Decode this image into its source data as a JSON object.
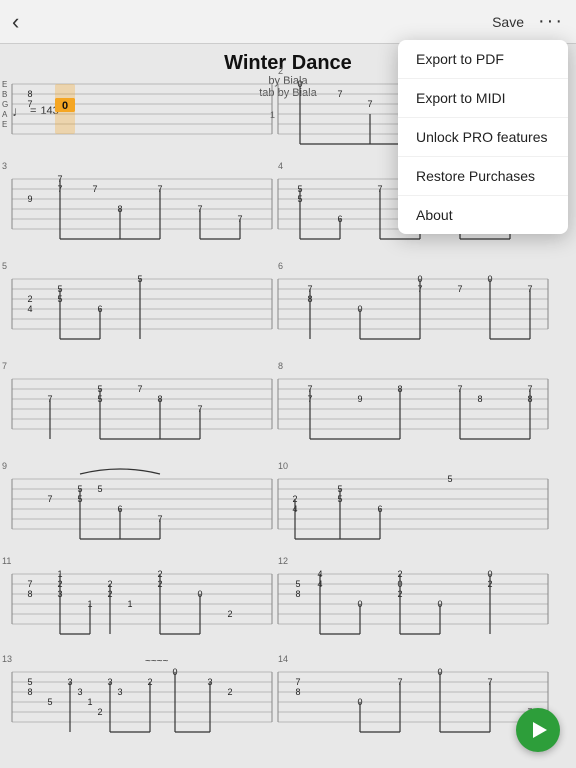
{
  "topbar": {
    "back_label": "‹",
    "save_label": "Save",
    "dots_label": "···"
  },
  "dropdown": {
    "items": [
      {
        "label": "Export to PDF",
        "id": "export-pdf"
      },
      {
        "label": "Export to MIDI",
        "id": "export-midi"
      },
      {
        "label": "Unlock PRO features",
        "id": "unlock-pro"
      },
      {
        "label": "Restore Purchases",
        "id": "restore-purchases"
      },
      {
        "label": "About",
        "id": "about"
      }
    ]
  },
  "song": {
    "title": "Winter Dance",
    "by": "by Biala",
    "tab_by": "tab by Biala",
    "tab_type": "guitar tab"
  },
  "meta": {
    "tempo_note": "♩",
    "tempo_equals": "=",
    "tempo_value": "143"
  },
  "playbutton": {
    "label": "▶"
  }
}
